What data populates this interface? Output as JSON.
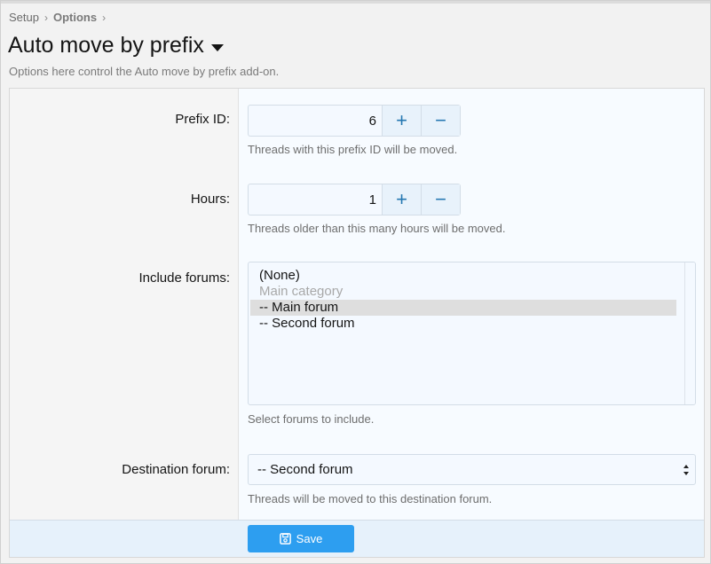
{
  "breadcrumb": {
    "items": [
      "Setup",
      "Options"
    ],
    "separator": "›"
  },
  "page": {
    "title": "Auto move by prefix",
    "description": "Options here control the Auto move by prefix add-on."
  },
  "fields": {
    "prefix_id": {
      "label": "Prefix ID:",
      "value": "6",
      "increment": "+",
      "decrement": "−",
      "hint": "Threads with this prefix ID will be moved."
    },
    "hours": {
      "label": "Hours:",
      "value": "1",
      "increment": "+",
      "decrement": "−",
      "hint": "Threads older than this many hours will be moved."
    },
    "include_forums": {
      "label": "Include forums:",
      "options": [
        {
          "text": "(None)",
          "state": "normal"
        },
        {
          "text": "Main category",
          "state": "disabled"
        },
        {
          "text": "-- Main forum",
          "state": "selected"
        },
        {
          "text": "-- Second forum",
          "state": "normal"
        }
      ],
      "hint": "Select forums to include."
    },
    "destination_forum": {
      "label": "Destination forum:",
      "selected": "-- Second forum",
      "hint": "Threads will be moved to this destination forum."
    }
  },
  "footer": {
    "save_label": "Save"
  },
  "colors": {
    "accent": "#2d9ef0",
    "stepper_icon": "#2577b1"
  },
  "icons": {
    "title_menu": "caret-down-icon",
    "save": "floppy-disk-icon",
    "select": "select-arrows-icon"
  }
}
